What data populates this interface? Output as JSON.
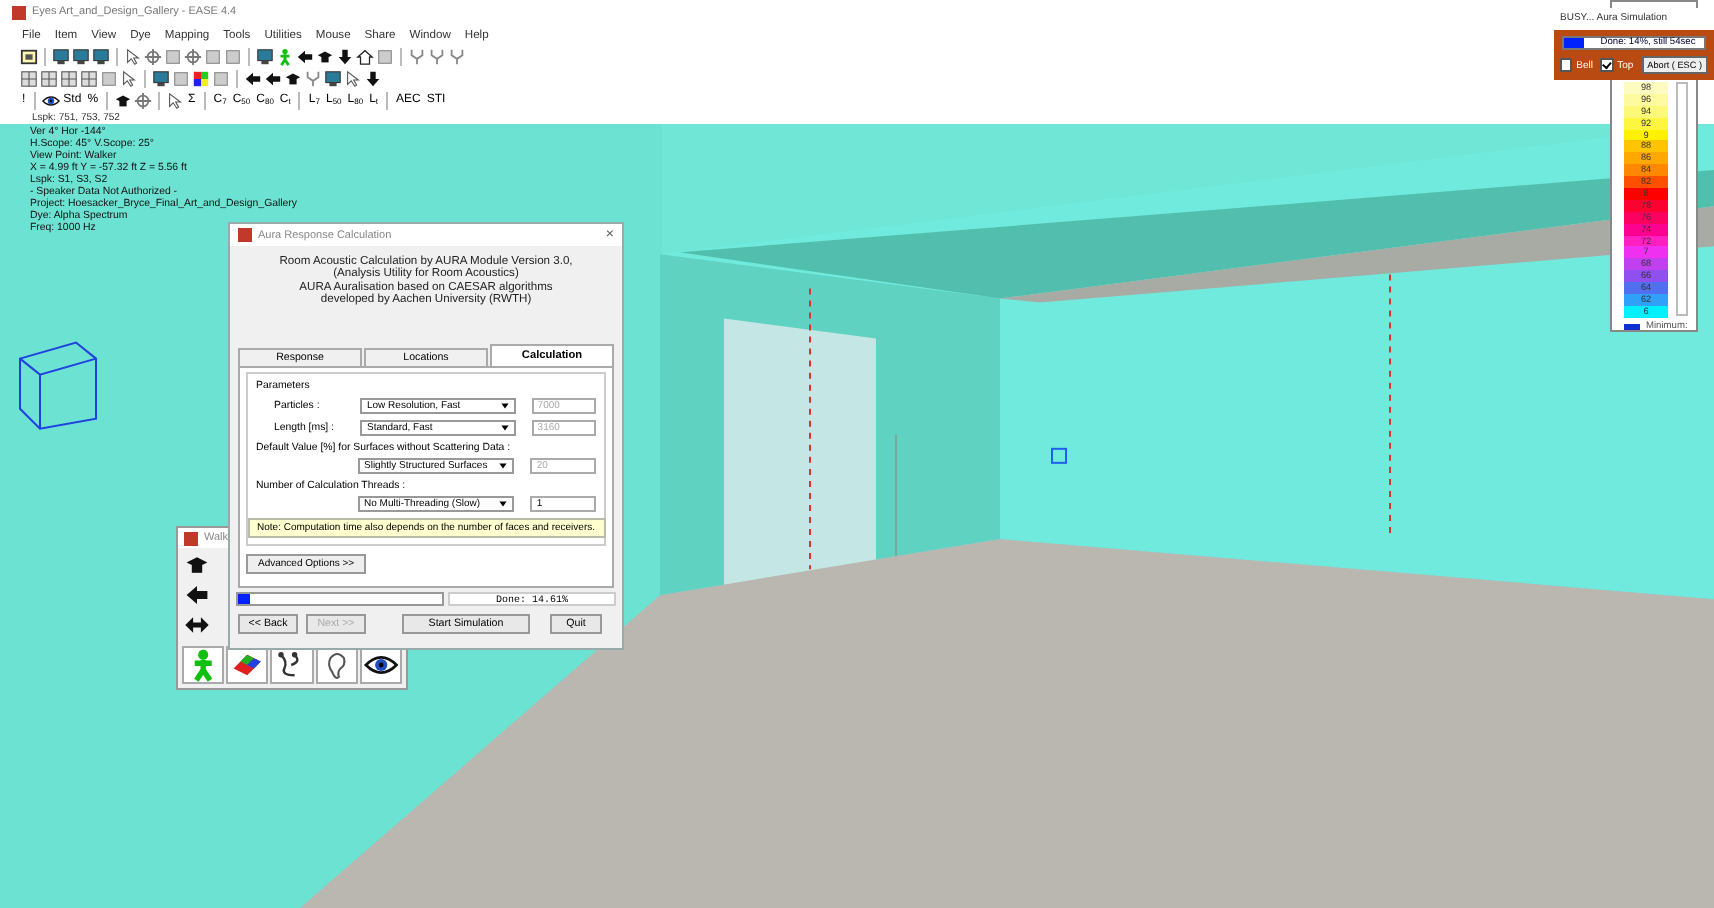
{
  "window": {
    "title": "Eyes Art_and_Design_Gallery - EASE 4.4"
  },
  "menu": [
    "File",
    "Item",
    "View",
    "Dye",
    "Mapping",
    "Tools",
    "Utilities",
    "Mouse",
    "Share",
    "Window",
    "Help"
  ],
  "toolbars": [
    [
      {
        "kind": "frame"
      },
      {
        "kind": "sep"
      },
      {
        "kind": "screen"
      },
      {
        "kind": "screen"
      },
      {
        "kind": "screen"
      },
      {
        "kind": "sep"
      },
      {
        "kind": "cursor"
      },
      {
        "kind": "crosshair"
      },
      {
        "kind": "square"
      },
      {
        "kind": "crosshair"
      },
      {
        "kind": "square"
      },
      {
        "kind": "square"
      },
      {
        "kind": "sep"
      },
      {
        "kind": "screen"
      },
      {
        "kind": "person"
      },
      {
        "kind": "arrow-left"
      },
      {
        "kind": "cap"
      },
      {
        "kind": "arrow-down"
      },
      {
        "kind": "house"
      },
      {
        "kind": "square"
      },
      {
        "kind": "sep"
      },
      {
        "kind": "branch"
      },
      {
        "kind": "branch"
      },
      {
        "kind": "branch"
      }
    ],
    [
      {
        "kind": "grid"
      },
      {
        "kind": "grid"
      },
      {
        "kind": "grid"
      },
      {
        "kind": "grid"
      },
      {
        "kind": "square"
      },
      {
        "kind": "cursor"
      },
      {
        "kind": "sep"
      },
      {
        "kind": "screen"
      },
      {
        "kind": "square"
      },
      {
        "kind": "palette"
      },
      {
        "kind": "square"
      },
      {
        "kind": "sep"
      },
      {
        "kind": "arrow-left"
      },
      {
        "kind": "arrow-left"
      },
      {
        "kind": "cap"
      },
      {
        "kind": "branch"
      },
      {
        "kind": "screen"
      },
      {
        "kind": "cursor"
      },
      {
        "kind": "arrow-down"
      }
    ],
    [
      {
        "kind": "text",
        "label": "!"
      },
      {
        "kind": "sep"
      },
      {
        "kind": "eye"
      },
      {
        "kind": "text",
        "label": "Std"
      },
      {
        "kind": "text",
        "label": "%"
      },
      {
        "kind": "sep"
      },
      {
        "kind": "cap"
      },
      {
        "kind": "crosshair"
      },
      {
        "kind": "sep"
      },
      {
        "kind": "cursor"
      },
      {
        "kind": "text",
        "label": "Σ"
      },
      {
        "kind": "sep"
      },
      {
        "kind": "text",
        "label": "C$_{7}$"
      },
      {
        "kind": "text",
        "label": "C$_{50}$"
      },
      {
        "kind": "text",
        "label": "C$_{80}$"
      },
      {
        "kind": "text",
        "label": "C$_{t}$"
      },
      {
        "kind": "sep"
      },
      {
        "kind": "text",
        "label": "L$_{7}$"
      },
      {
        "kind": "text",
        "label": "L$_{50}$"
      },
      {
        "kind": "text",
        "label": "L$_{80}$"
      },
      {
        "kind": "text",
        "label": "L$_{t}$"
      },
      {
        "kind": "sep"
      },
      {
        "kind": "text",
        "label": "AEC"
      },
      {
        "kind": "text",
        "label": "STI"
      }
    ]
  ],
  "status_line": "Lspk: 751, 753, 752",
  "info_lines": [
    "Ver 4°  Hor -144°",
    "H.Scope: 45°  V.Scope: 25°",
    "View Point: Walker",
    "X =   4.99 ft  Y =  -57.32 ft  Z =    5.56 ft",
    "Lspk: S1, S3, S2",
    "- Speaker Data Not Authorized -",
    "Project: Hoesacker_Bryce_Final_Art_and_Design_Gallery",
    "Dye: Alpha Spectrum",
    "Freq: 1000 Hz"
  ],
  "dialog": {
    "title": "Aura Response Calculation",
    "close": "×",
    "header": [
      "Room Acoustic Calculation by AURA Module Version 3.0,",
      "(Analysis Utility for Room Acoustics)",
      "AURA Auralisation based on CAESAR algorithms",
      "developed by Aachen University (RWTH)"
    ],
    "tabs": [
      {
        "label": "Response",
        "selected": false
      },
      {
        "label": "Locations",
        "selected": false
      },
      {
        "label": "Calculation",
        "selected": true
      }
    ],
    "group": "Parameters",
    "params": [
      {
        "label": "Particles :",
        "option": "Low Resolution, Fast",
        "value": "7000",
        "disabled": true,
        "stacked": false
      },
      {
        "label": "Length [ms] :",
        "option": "Standard, Fast",
        "value": "3160",
        "disabled": true,
        "stacked": false
      },
      {
        "label": "Default Value [%] for Surfaces without Scattering Data :",
        "option": "Slightly Structured Surfaces",
        "value": "20",
        "disabled": true,
        "stacked": true
      },
      {
        "label": "Number of Calculation Threads :",
        "option": "No Multi-Threading (Slow)",
        "value": "1",
        "disabled": false,
        "stacked": true
      }
    ],
    "note": "Note: Computation time also depends on the number of faces and receivers.",
    "advanced": "Advanced Options >>",
    "progress": {
      "level": 0.06,
      "reading": "Done: 14.61%"
    },
    "buttons": [
      {
        "label": "<< Back",
        "disabled": false
      },
      {
        "label": "Next >>",
        "disabled": true
      },
      {
        "label": "Start Simulation",
        "disabled": false
      },
      {
        "label": "Quit",
        "disabled": false
      }
    ]
  },
  "walker": {
    "title": "Walk",
    "side": [
      {
        "kind": "cap"
      },
      {
        "kind": "arrow-left"
      },
      {
        "kind": "double-arrow"
      }
    ],
    "bottom": [
      {
        "kind": "person"
      },
      {
        "kind": "eraser"
      },
      {
        "kind": "cable"
      },
      {
        "kind": "ear"
      },
      {
        "kind": "eye"
      }
    ]
  },
  "busy": {
    "title": "BUSY... Aura Simulation",
    "progress": {
      "level": 0.14,
      "reading": "Done: 14%, still 54sec"
    },
    "checks": [
      {
        "label": "Bell",
        "checked": false
      },
      {
        "label": "Top",
        "checked": true
      }
    ],
    "abort": "Abort ( ESC )"
  },
  "legend": {
    "scale": [
      {
        "label": "98",
        "color": "#fdfbc0"
      },
      {
        "label": "96",
        "color": "#fdfaa0"
      },
      {
        "label": "94",
        "color": "#fdf878"
      },
      {
        "label": "92",
        "color": "#fdf640"
      },
      {
        "label": "9",
        "color": "#fef200"
      },
      {
        "label": "88",
        "color": "#ffc400"
      },
      {
        "label": "86",
        "color": "#ffa800"
      },
      {
        "label": "84",
        "color": "#ff8800"
      },
      {
        "label": "82",
        "color": "#ff5000"
      },
      {
        "label": "8",
        "color": "#ff0000"
      },
      {
        "label": "78",
        "color": "#ff0030"
      },
      {
        "label": "76",
        "color": "#ff0060"
      },
      {
        "label": "74",
        "color": "#ff0090"
      },
      {
        "label": "72",
        "color": "#ff20c0"
      },
      {
        "label": "7",
        "color": "#f030f0"
      },
      {
        "label": "68",
        "color": "#c040f0"
      },
      {
        "label": "66",
        "color": "#9050f0"
      },
      {
        "label": "64",
        "color": "#5070f0"
      },
      {
        "label": "62",
        "color": "#30a0f8"
      },
      {
        "label": "6",
        "color": "#00f0ff"
      }
    ],
    "minimum": "Minimum:"
  }
}
